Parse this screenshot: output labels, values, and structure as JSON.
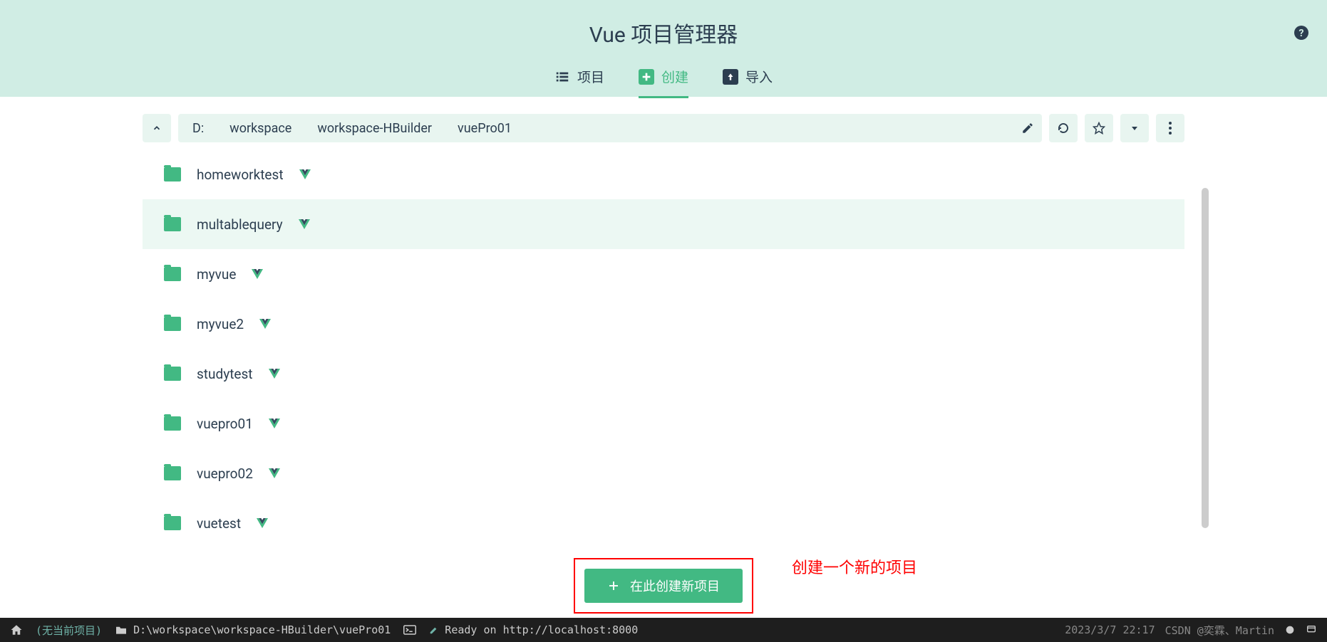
{
  "header": {
    "title": "Vue 项目管理器",
    "tabs": [
      {
        "label": "项目",
        "icon": "list"
      },
      {
        "label": "创建",
        "icon": "plus",
        "active": true
      },
      {
        "label": "导入",
        "icon": "upload"
      }
    ]
  },
  "breadcrumb": [
    "D:",
    "workspace",
    "workspace-HBuilder",
    "vuePro01"
  ],
  "files": [
    {
      "name": "homeworktest",
      "vue": true
    },
    {
      "name": "multablequery",
      "vue": true,
      "selected": true
    },
    {
      "name": "myvue",
      "vue": true
    },
    {
      "name": "myvue2",
      "vue": true
    },
    {
      "name": "studytest",
      "vue": true
    },
    {
      "name": "vuepro01",
      "vue": true
    },
    {
      "name": "vuepro02",
      "vue": true
    },
    {
      "name": "vuetest",
      "vue": true
    }
  ],
  "create": {
    "button_label": "在此创建新项目",
    "annotation": "创建一个新的项目"
  },
  "statusbar": {
    "no_project": "(无当前项目)",
    "path": "D:\\workspace\\workspace-HBuilder\\vuePro01",
    "ready": "Ready on http://localhost:8000",
    "timestamp": "2023/3/7 22:17",
    "watermark": "CSDN @奕霖、Martin"
  }
}
